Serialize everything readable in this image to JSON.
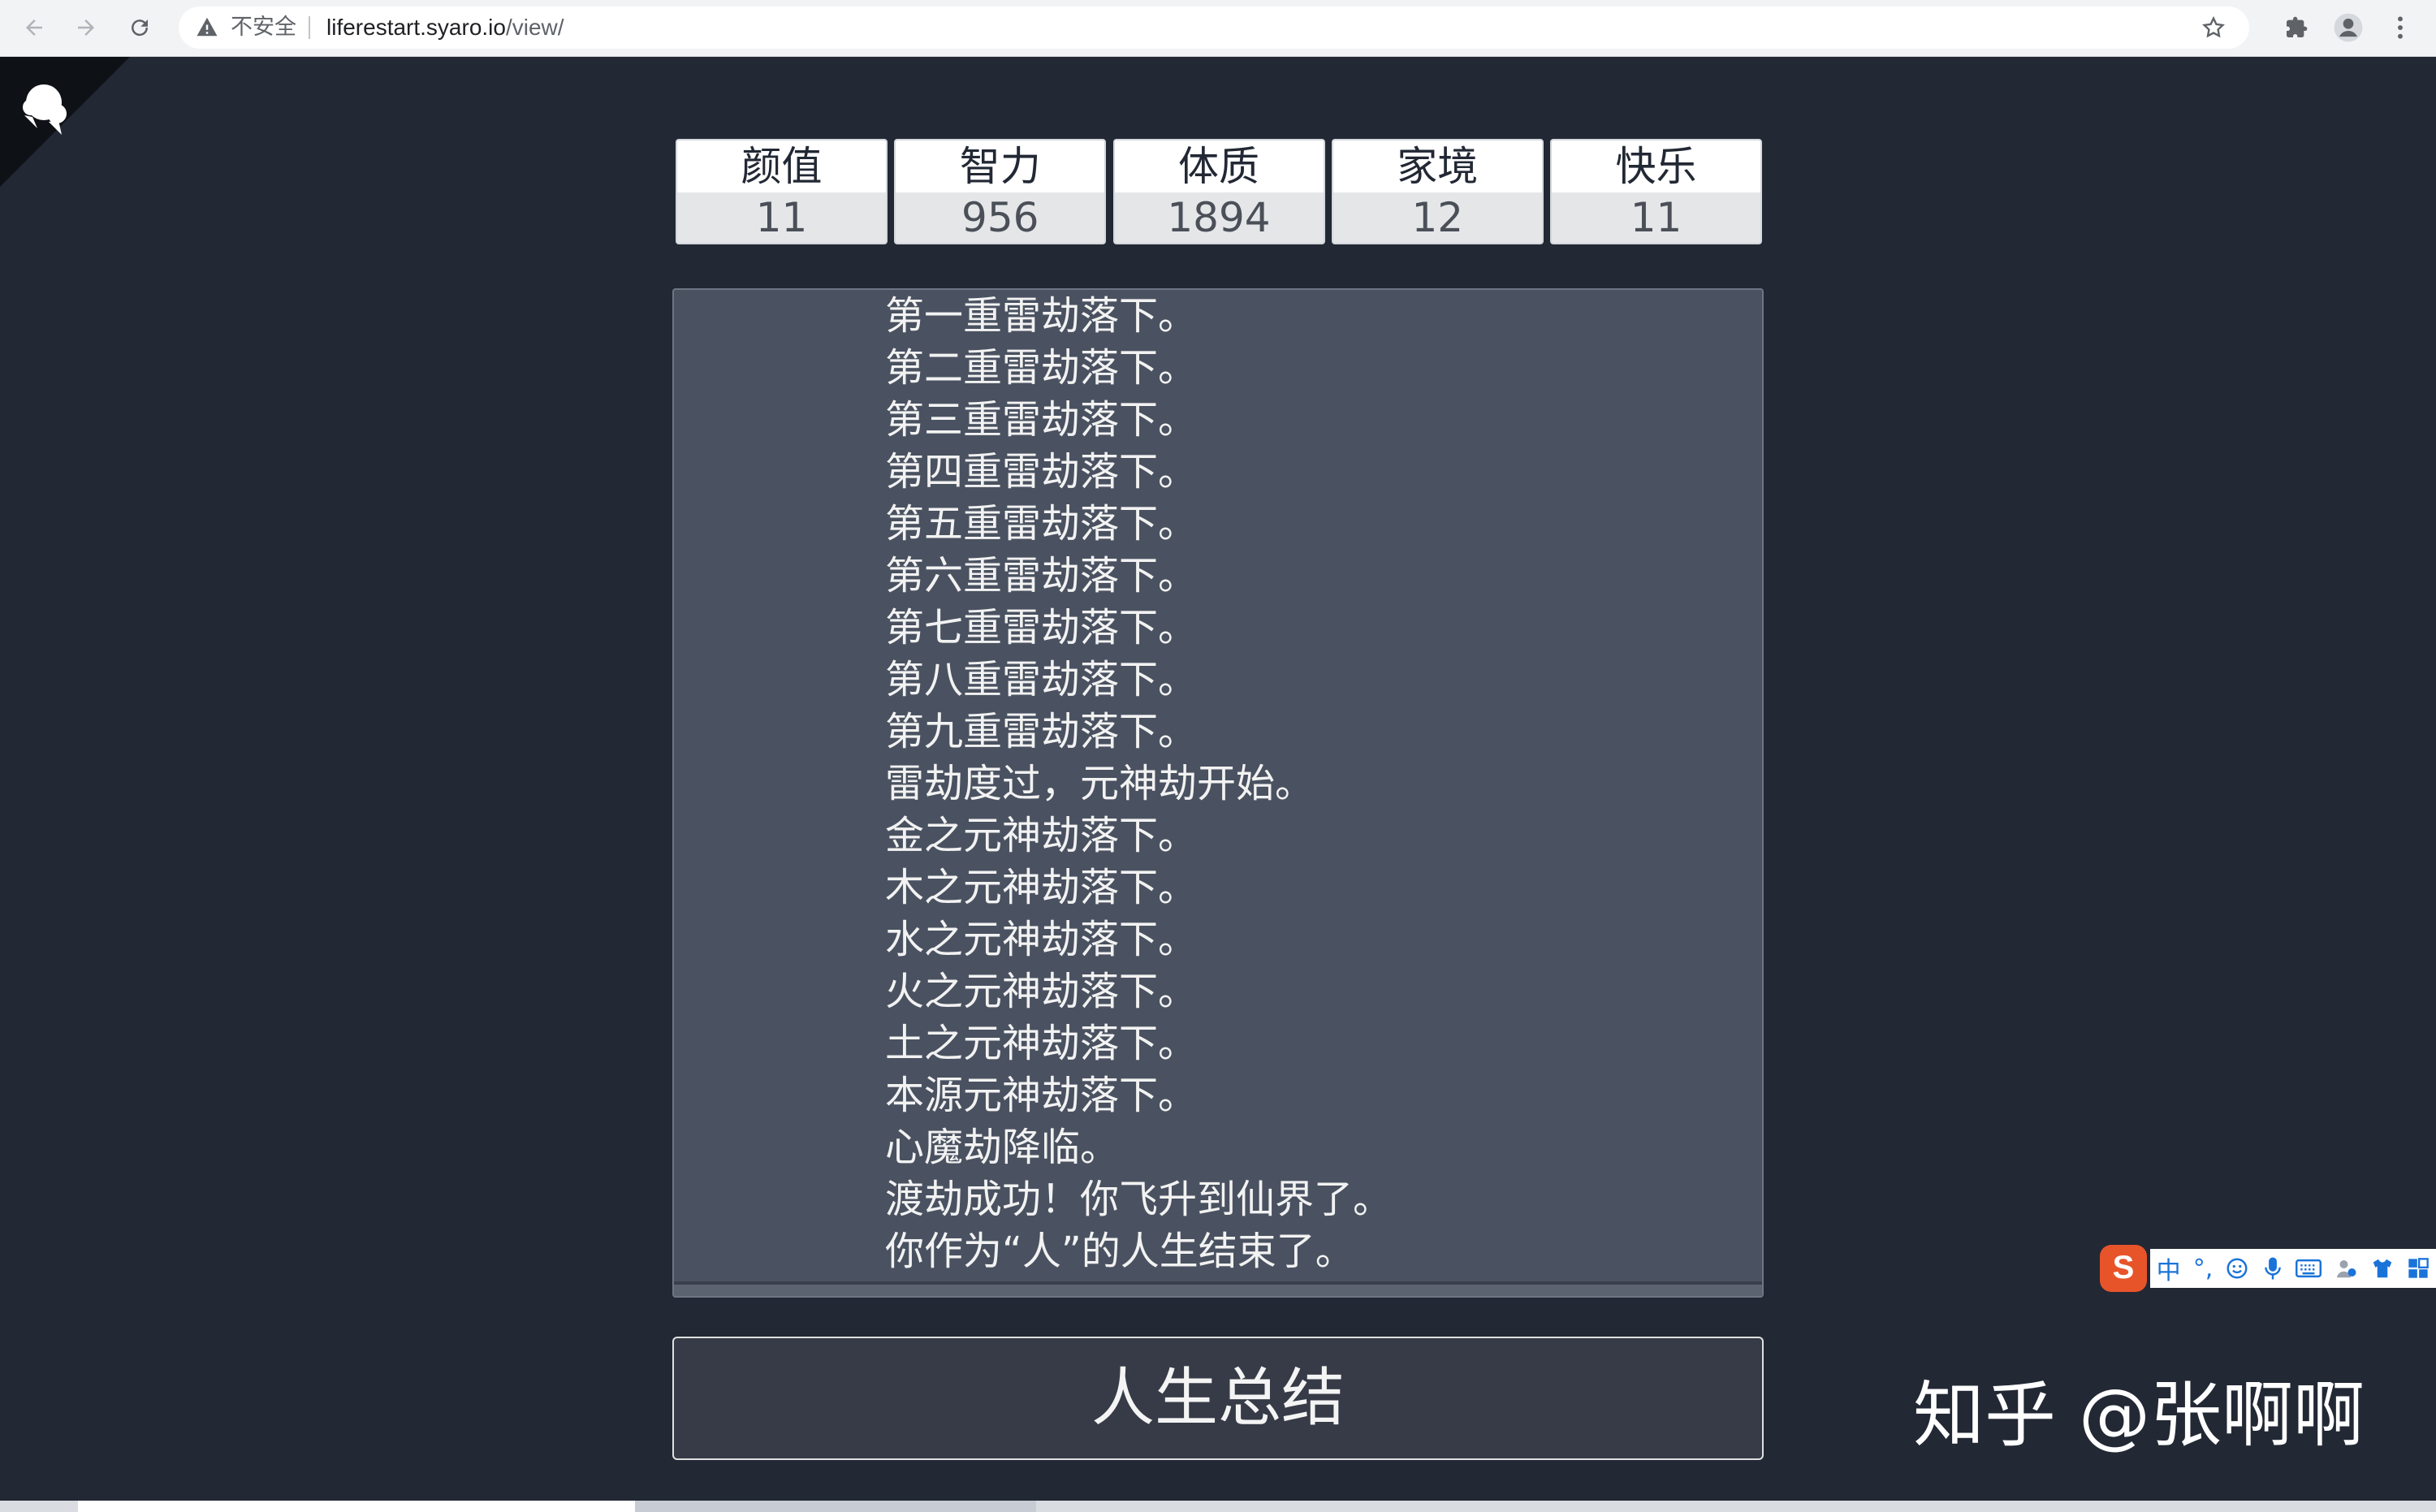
{
  "browser": {
    "security_label": "不安全",
    "url_host": "liferestart.syaro.io",
    "url_path": "/view/"
  },
  "stats": [
    {
      "label": "颜值",
      "value": "11"
    },
    {
      "label": "智力",
      "value": "956"
    },
    {
      "label": "体质",
      "value": "1894"
    },
    {
      "label": "家境",
      "value": "12"
    },
    {
      "label": "快乐",
      "value": "11"
    }
  ],
  "log": [
    "第一重雷劫落下。",
    "第二重雷劫落下。",
    "第三重雷劫落下。",
    "第四重雷劫落下。",
    "第五重雷劫落下。",
    "第六重雷劫落下。",
    "第七重雷劫落下。",
    "第八重雷劫落下。",
    "第九重雷劫落下。",
    "雷劫度过，元神劫开始。",
    "金之元神劫落下。",
    "木之元神劫落下。",
    "水之元神劫落下。",
    "火之元神劫落下。",
    "土之元神劫落下。",
    "本源元神劫落下。",
    "心魔劫降临。",
    "渡劫成功！你飞升到仙界了。",
    "你作为“人”的人生结束了。"
  ],
  "summary_button": "人生总结",
  "ime": {
    "logo": "S",
    "mode": "中"
  },
  "watermark": "知乎 @张啊啊"
}
